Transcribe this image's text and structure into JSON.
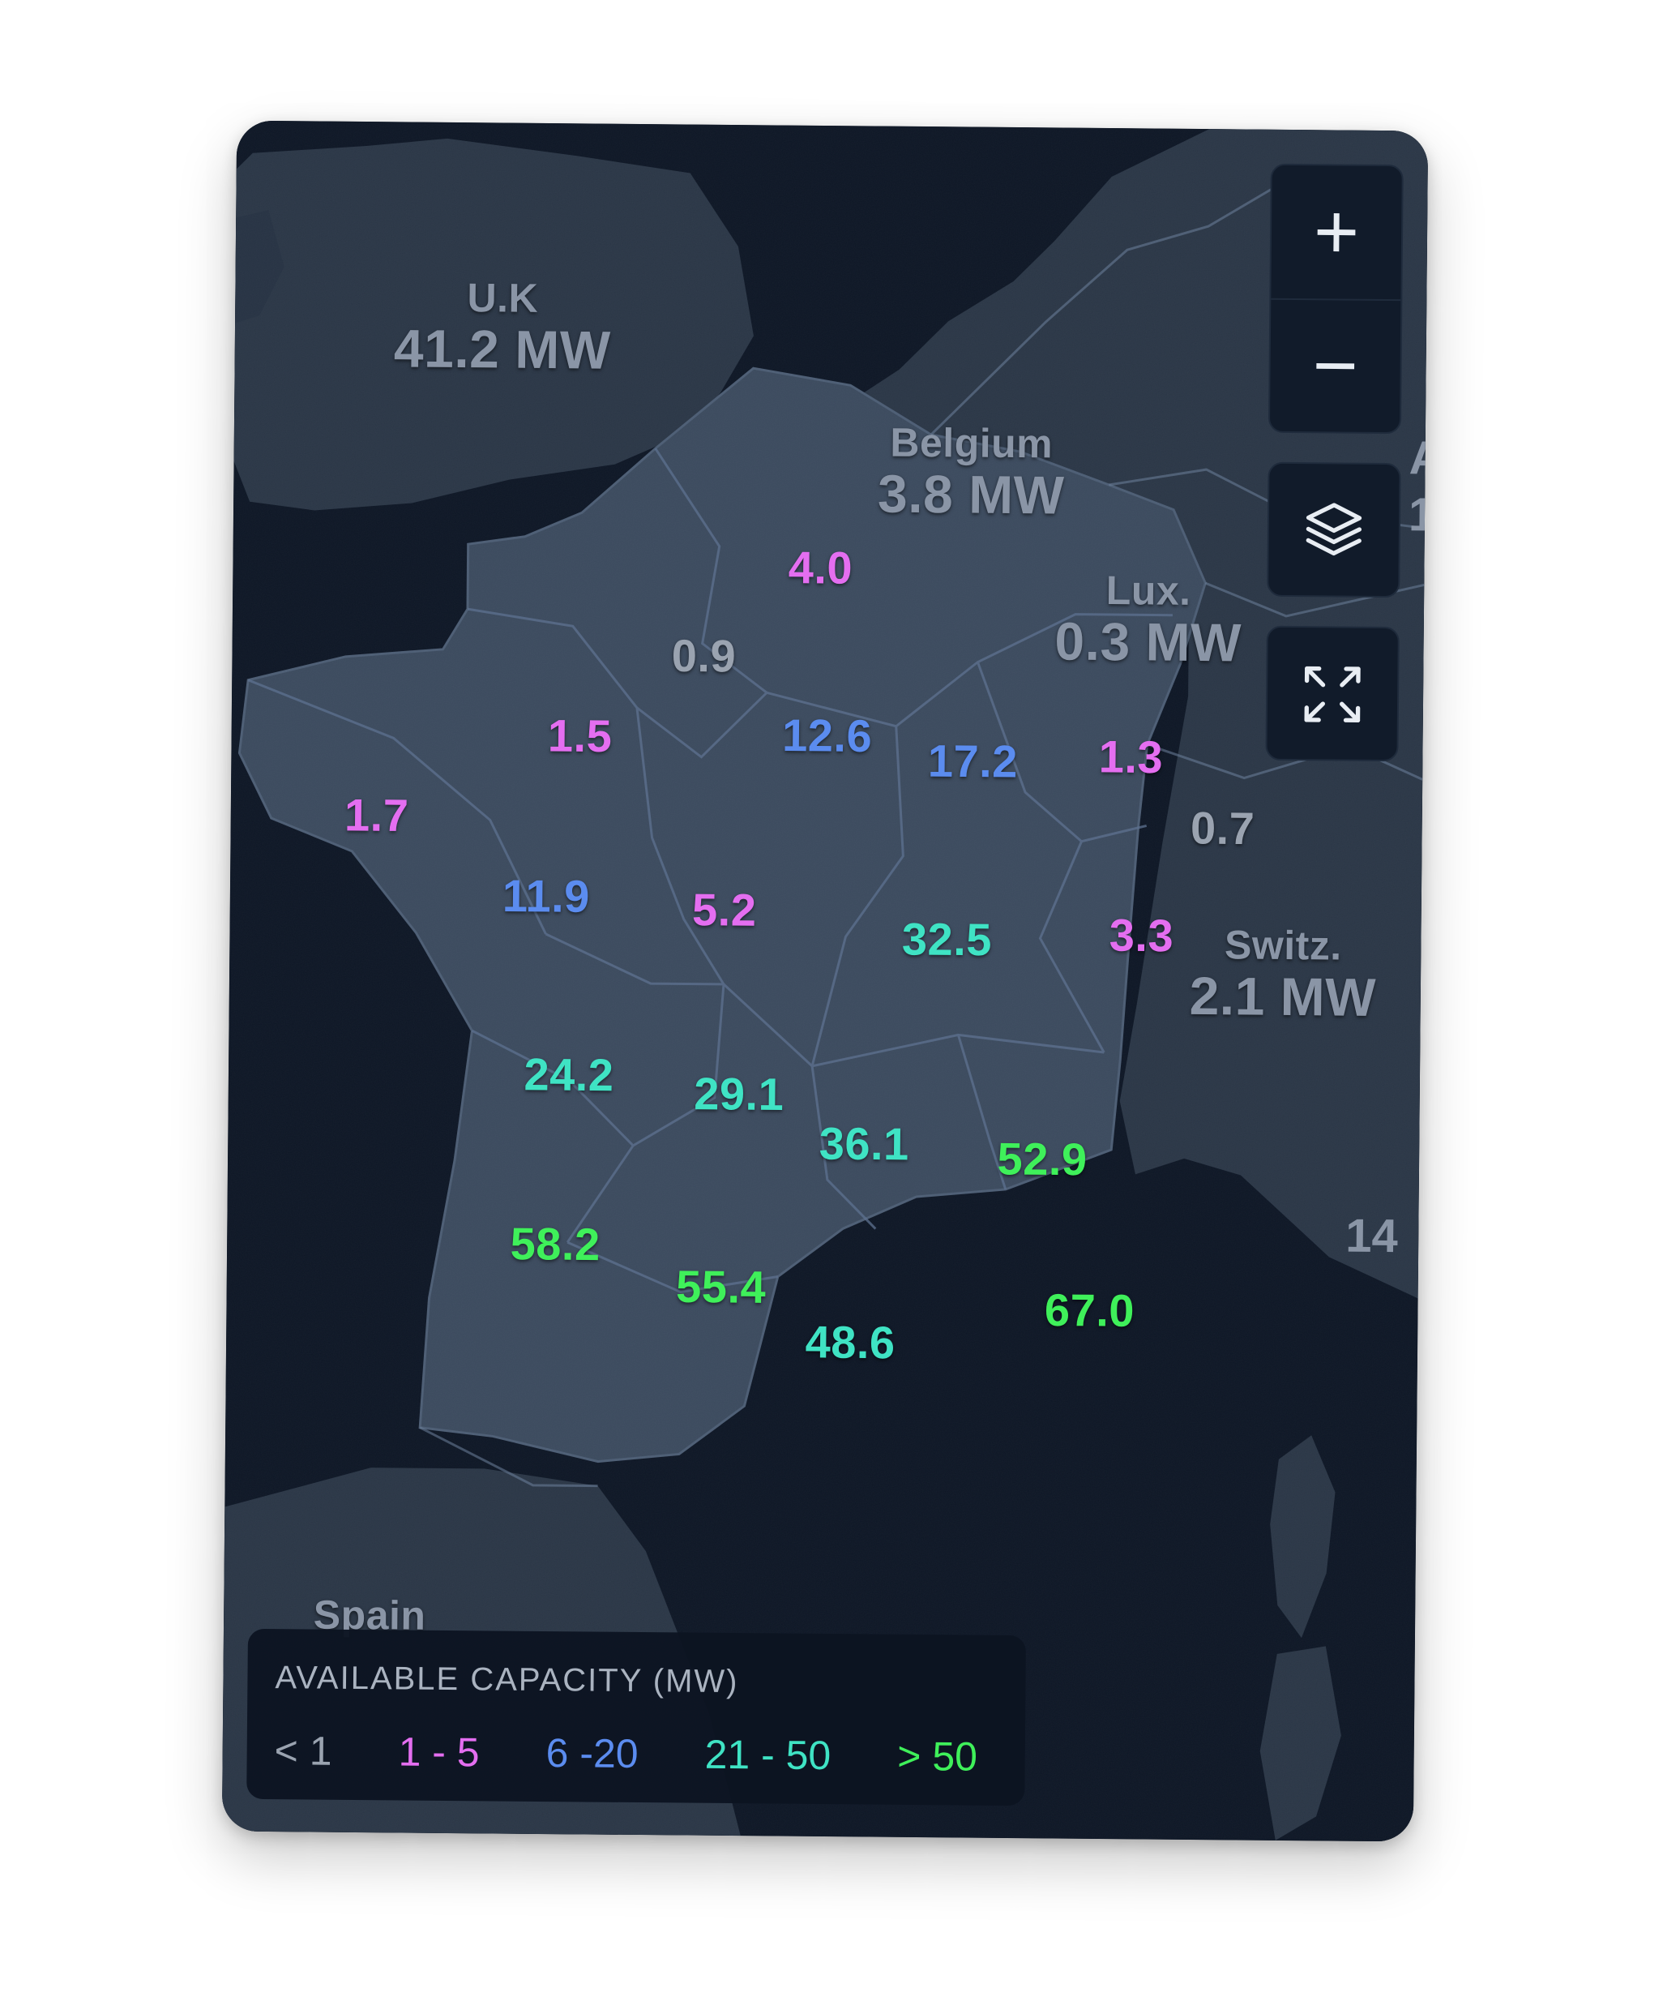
{
  "countries": [
    {
      "key": "uk",
      "name": "U.K",
      "value": "41.2 MW"
    },
    {
      "key": "belgium",
      "name": "Belgium",
      "value": "3.8 MW"
    },
    {
      "key": "lux",
      "name": "Lux.",
      "value": "0.3 MW"
    },
    {
      "key": "switz",
      "name": "Switz.",
      "value": "2.1 MW"
    },
    {
      "key": "spain",
      "name": "Spain",
      "value": ""
    }
  ],
  "regions": [
    {
      "value": "4.0",
      "tier": "1-5"
    },
    {
      "value": "0.9",
      "tier": "<1"
    },
    {
      "value": "1.5",
      "tier": "1-5"
    },
    {
      "value": "12.6",
      "tier": "6-20"
    },
    {
      "value": "17.2",
      "tier": "6-20"
    },
    {
      "value": "1.3",
      "tier": "1-5"
    },
    {
      "value": "1.7",
      "tier": "1-5"
    },
    {
      "value": "0.7",
      "tier": "<1"
    },
    {
      "value": "11.9",
      "tier": "6-20"
    },
    {
      "value": "5.2",
      "tier": "1-5"
    },
    {
      "value": "32.5",
      "tier": "21-50"
    },
    {
      "value": "3.3",
      "tier": "1-5"
    },
    {
      "value": "24.2",
      "tier": "21-50"
    },
    {
      "value": "29.1",
      "tier": "21-50"
    },
    {
      "value": "36.1",
      "tier": "21-50"
    },
    {
      "value": "52.9",
      "tier": ">50"
    },
    {
      "value": "58.2",
      "tier": ">50"
    },
    {
      "value": "55.4",
      "tier": ">50"
    },
    {
      "value": "67.0",
      "tier": ">50"
    },
    {
      "value": "48.6",
      "tier": "21-50"
    }
  ],
  "edge_labels": {
    "right_top": "A",
    "right_mid_1": "1",
    "right_mid_2": "14"
  },
  "controls": {
    "zoom_in": "+",
    "zoom_out": "−",
    "layers_icon": "layers-icon",
    "fullscreen_icon": "expand-icon"
  },
  "legend": {
    "title": "AVAILABLE CAPACITY (MW)",
    "items": [
      {
        "label": "< 1",
        "tier": "<1"
      },
      {
        "label": "1 - 5",
        "tier": "1-5"
      },
      {
        "label": "6 -20",
        "tier": "6-20"
      },
      {
        "label": "21 - 50",
        "tier": "21-50"
      },
      {
        "label": "> 50",
        "tier": ">50"
      }
    ]
  },
  "colors": {
    "<1": "#9aa3b0",
    "1-5": "#e46ef0",
    "6-20": "#5b8cef",
    "21-50": "#3fe3c4",
    ">50": "#3ff05a",
    "water": "#0d1625",
    "land": "#2a3646",
    "france": "#3b4a5e",
    "border": "#5b6e88"
  }
}
